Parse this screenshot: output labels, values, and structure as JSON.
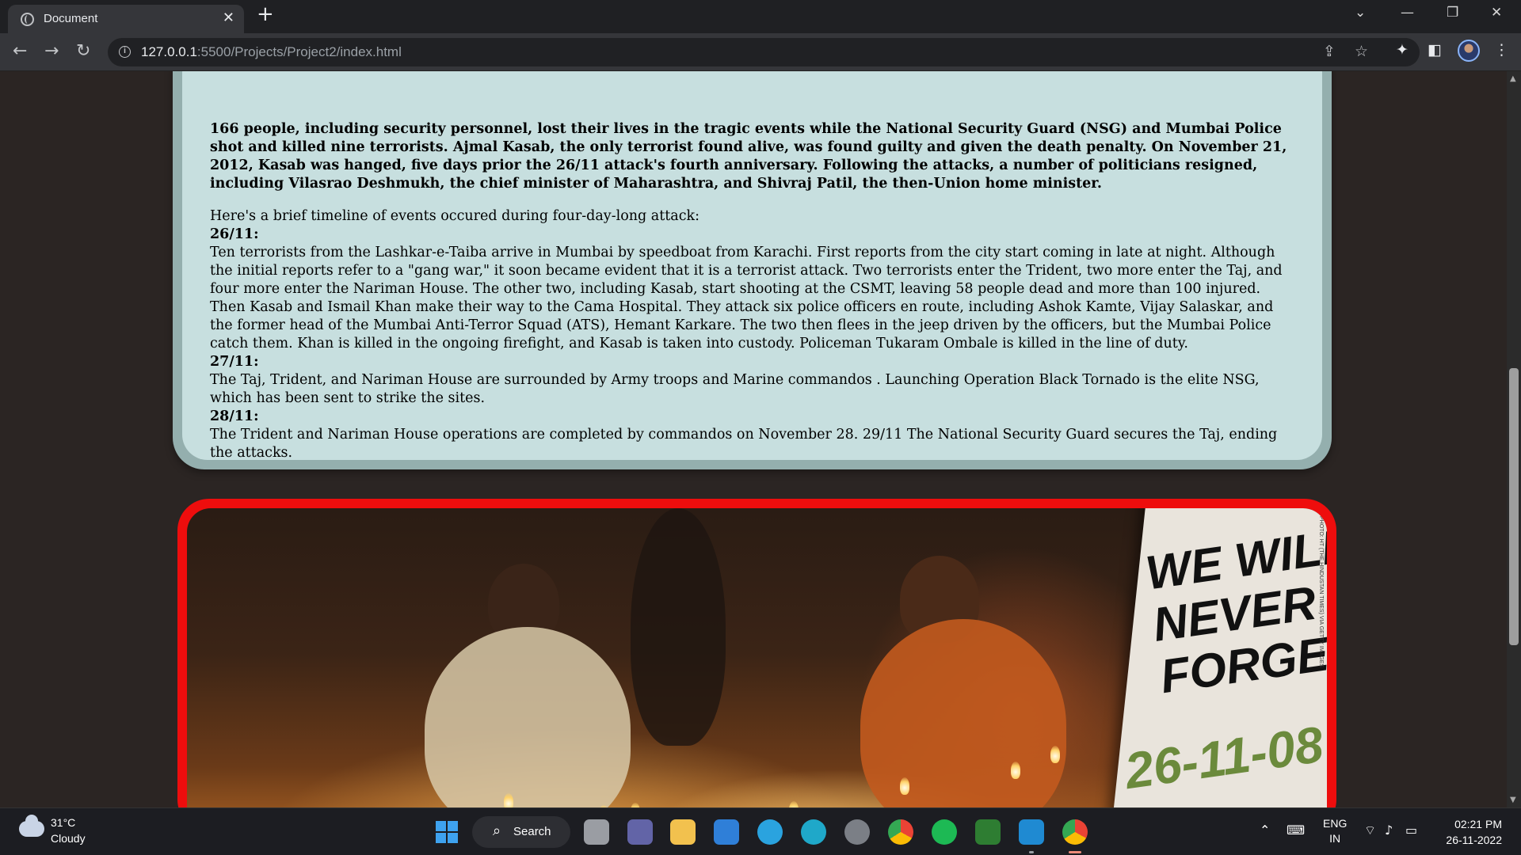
{
  "browser": {
    "tab_title": "Document",
    "tab_close": "✕",
    "new_tab": "+",
    "url_host": "127.0.0.1",
    "url_path": ":5500/Projects/Project2/index.html"
  },
  "article": {
    "intro": "166 people, including security personnel, lost their lives in the tragic events while the National Security Guard (NSG) and Mumbai Police shot and killed nine terrorists. Ajmal Kasab, the only terrorist found alive, was found guilty and given the death penalty. On November 21, 2012, Kasab was hanged, five days prior the 26/11 attack's fourth anniversary. Following the attacks, a number of politicians resigned, including Vilasrao Deshmukh, the chief minister of Maharashtra, and Shivraj Patil, the then-Union home minister.",
    "timeline_intro": "Here's a brief timeline of events occured during four-day-long attack:",
    "timeline": [
      {
        "date": "26/11:",
        "text": "Ten terrorists from the Lashkar-e-Taiba arrive in Mumbai by speedboat from Karachi. First reports from the city start coming in late at night. Although the initial reports refer to a \"gang war,\" it soon became evident that it is a terrorist attack. Two terrorists enter the Trident, two more enter the Taj, and four more enter the Nariman House. The other two, including Kasab, start shooting at the CSMT, leaving 58 people dead and more than 100 injured. Then Kasab and Ismail Khan make their way to the Cama Hospital. They attack six police officers en route, including Ashok Kamte, Vijay Salaskar, and the former head of the Mumbai Anti-Terror Squad (ATS), Hemant Karkare. The two then flees in the jeep driven by the officers, but the Mumbai Police catch them. Khan is killed in the ongoing firefight, and Kasab is taken into custody. Policeman Tukaram Ombale is killed in the line of duty."
      },
      {
        "date": "27/11:",
        "text": "The Taj, Trident, and Nariman House are surrounded by Army troops and Marine commandos . Launching Operation Black Tornado is the elite NSG, which has been sent to strike the sites."
      },
      {
        "date": "28/11:",
        "text": "The Trident and Nariman House operations are completed by commandos on November 28. 29/11 The National Security Guard secures the Taj, ending the attacks."
      }
    ]
  },
  "memorial": {
    "sign_line1": "WE WILL",
    "sign_line2": "NEVER",
    "sign_line3": "FORGET",
    "sign_date": "26-11-08",
    "photo_credit": "PHOTO: HT (THE HINDUSTAN TIMES) VIA GETTY IMAGES"
  },
  "taskbar": {
    "weather_temp": "31°C",
    "weather_cond": "Cloudy",
    "search_label": "Search",
    "lang_top": "ENG",
    "lang_bottom": "IN",
    "time": "02:21 PM",
    "date": "26-11-2022"
  },
  "colors": {
    "page_bg": "#2b2523",
    "card_border": "#94afae",
    "card_bg": "#c7dfdf",
    "photo_frame": "#ee0d0d"
  }
}
